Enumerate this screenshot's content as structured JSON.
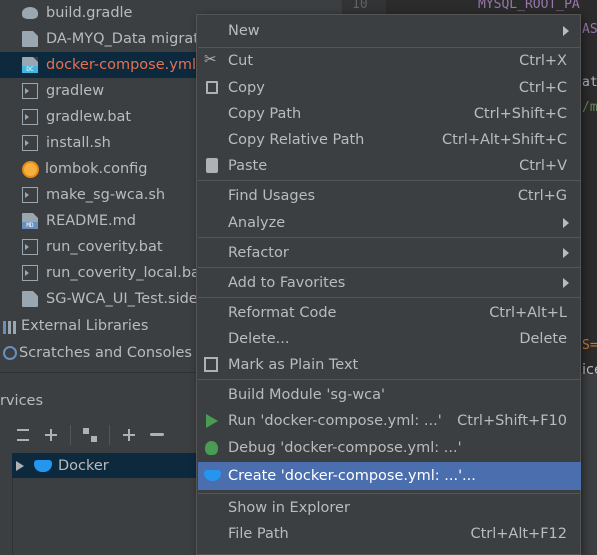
{
  "project_tree": {
    "items": [
      {
        "label": "build.gradle",
        "icon": "gradle-elephant-icon"
      },
      {
        "label": "DA-MYQ_Data migrat",
        "icon": "file-icon"
      },
      {
        "label": "docker-compose.yml",
        "icon": "yaml-file-icon",
        "tag": "DC",
        "selected": true
      },
      {
        "label": "gradlew",
        "icon": "shell-file-icon"
      },
      {
        "label": "gradlew.bat",
        "icon": "bat-file-icon"
      },
      {
        "label": "install.sh",
        "icon": "shell-file-icon"
      },
      {
        "label": "lombok.config",
        "icon": "config-sun-icon"
      },
      {
        "label": "make_sg-wca.sh",
        "icon": "shell-file-icon"
      },
      {
        "label": "README.md",
        "icon": "markdown-file-icon",
        "tag": "MD"
      },
      {
        "label": "run_coverity.bat",
        "icon": "bat-file-icon"
      },
      {
        "label": "run_coverity_local.bat",
        "icon": "bat-file-icon"
      },
      {
        "label": "SG-WCA_UI_Test.side",
        "icon": "file-icon"
      }
    ],
    "external_libraries": "External Libraries",
    "scratches": "Scratches and Consoles"
  },
  "editor": {
    "line_number": "10",
    "snippets": [
      "MYSQL_ROOT_PA",
      "AS",
      "ata",
      "/my",
      "S=",
      "ice"
    ]
  },
  "services": {
    "title": "rvices",
    "docker_label": "Docker"
  },
  "context_menu": {
    "items": [
      {
        "label": "New",
        "submenu": true
      },
      {
        "label": "Cut",
        "shortcut": "Ctrl+X",
        "icon": "cut-icon"
      },
      {
        "label": "Copy",
        "shortcut": "Ctrl+C",
        "icon": "copy-icon"
      },
      {
        "label": "Copy Path",
        "shortcut": "Ctrl+Shift+C"
      },
      {
        "label": "Copy Relative Path",
        "shortcut": "Ctrl+Alt+Shift+C"
      },
      {
        "label": "Paste",
        "shortcut": "Ctrl+V",
        "icon": "paste-icon"
      },
      {
        "label": "Find Usages",
        "shortcut": "Ctrl+G"
      },
      {
        "label": "Analyze",
        "submenu": true
      },
      {
        "label": "Refactor",
        "submenu": true
      },
      {
        "label": "Add to Favorites",
        "submenu": true
      },
      {
        "label": "Reformat Code",
        "shortcut": "Ctrl+Alt+L"
      },
      {
        "label": "Delete...",
        "shortcut": "Delete"
      },
      {
        "label": "Mark as Plain Text",
        "icon": "mark-plain-text-icon"
      },
      {
        "label": "Build Module 'sg-wca'"
      },
      {
        "label": "Run 'docker-compose.yml: ...'",
        "shortcut": "Ctrl+Shift+F10",
        "icon": "run-icon"
      },
      {
        "label": "Debug 'docker-compose.yml: ...'",
        "icon": "debug-icon"
      },
      {
        "label": "Create 'docker-compose.yml: ...'...",
        "icon": "docker-icon",
        "highlighted": true
      },
      {
        "label": "Show in Explorer"
      },
      {
        "label": "File Path",
        "shortcut": "Ctrl+Alt+F12"
      }
    ]
  },
  "colors": {
    "panel_bg": "#3c3f41",
    "editor_bg": "#2b2b2b",
    "selection_bg": "#0d293e",
    "menu_highlight": "#4b6eaf",
    "selected_file_text": "#e6714f"
  }
}
